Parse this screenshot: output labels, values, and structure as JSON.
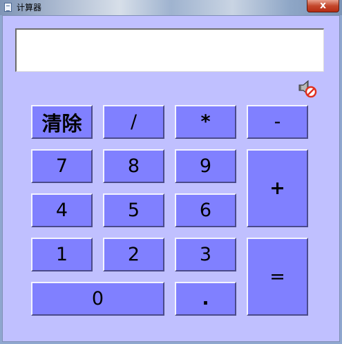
{
  "window": {
    "title": "计算器",
    "close_label": "x"
  },
  "display": {
    "value": ""
  },
  "sound_icon": "speaker-muted-icon",
  "keys": {
    "clear": "清除",
    "divide": "/",
    "multiply": "*",
    "minus": "-",
    "seven": "7",
    "eight": "8",
    "nine": "9",
    "plus": "+",
    "four": "4",
    "five": "5",
    "six": "6",
    "one": "1",
    "two": "2",
    "three": "3",
    "equals": "=",
    "zero": "0",
    "dot": "."
  },
  "colors": {
    "client_bg": "#c0c0ff",
    "key_bg": "#8080ff"
  }
}
